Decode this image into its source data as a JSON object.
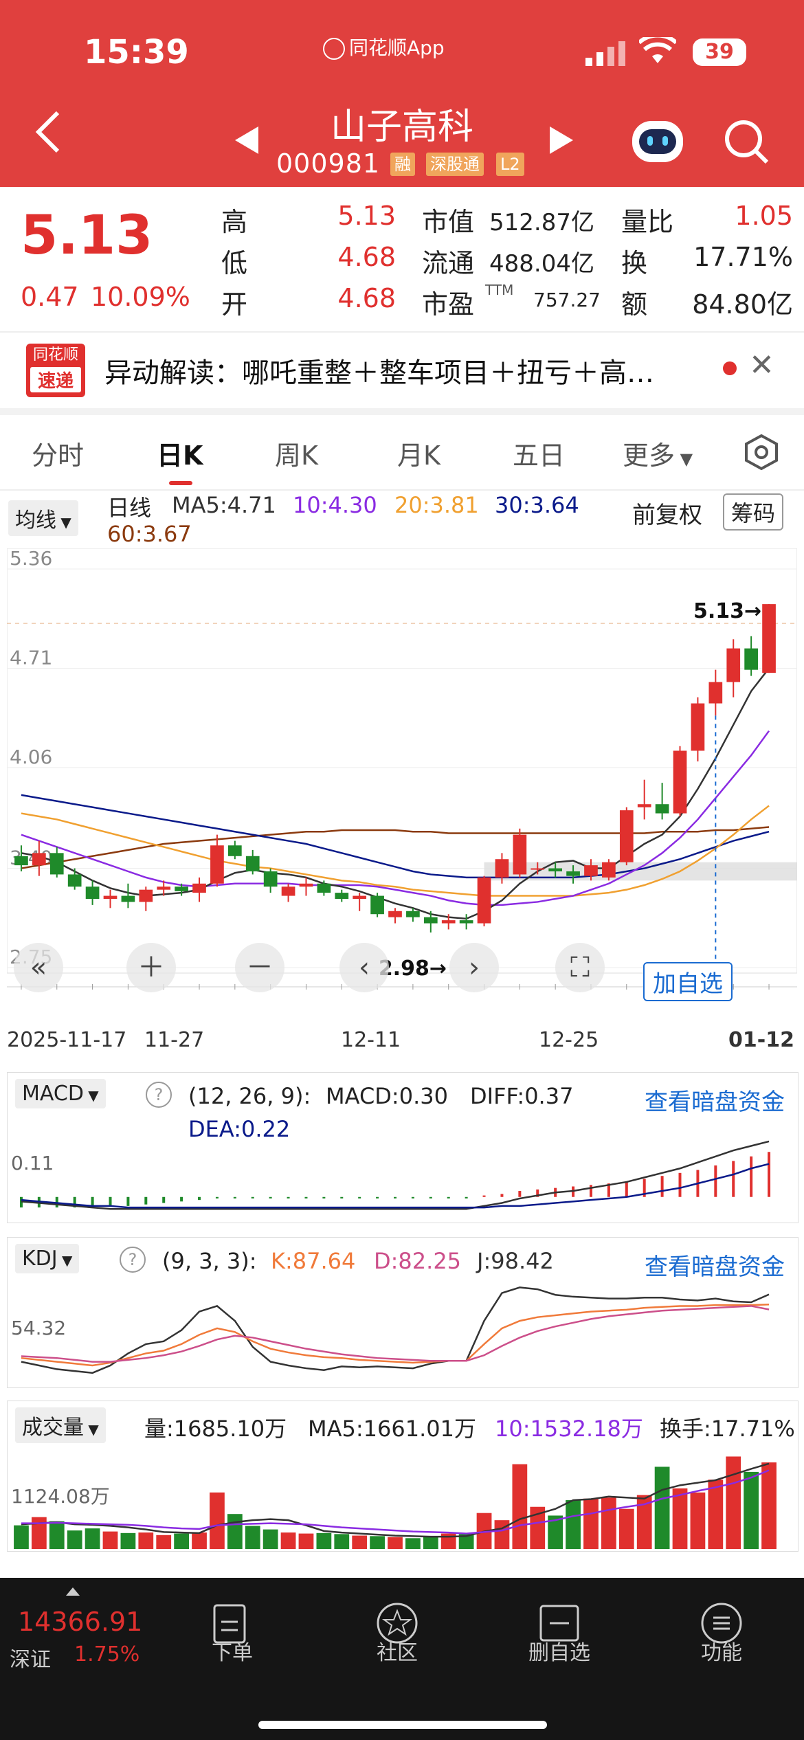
{
  "status": {
    "time": "15:39",
    "app": "同花顺App",
    "battery": "39"
  },
  "header": {
    "title": "山子高科",
    "code": "000981",
    "tags": [
      "融",
      "深股通",
      "L2"
    ]
  },
  "quote": {
    "price": "5.13",
    "change": "0.47",
    "pct": "10.09%",
    "rows": [
      {
        "l1": "高",
        "v1": "5.13",
        "l2": "市值",
        "v2": "512.87亿",
        "l3": "量比",
        "v3": "1.05"
      },
      {
        "l1": "低",
        "v1": "4.68",
        "l2": "流通",
        "v2": "488.04亿",
        "l3": "换",
        "v3": "17.71%"
      },
      {
        "l1": "开",
        "v1": "4.68",
        "l2": "市盈",
        "v2sup": "TTM",
        "v2": "757.27",
        "l3": "额",
        "v3": "84.80亿"
      }
    ]
  },
  "news": {
    "brand1": "同花顺",
    "brand2": "速递",
    "text": "异动解读：哪吒重整＋整车项目＋扭亏＋高…"
  },
  "tabs": [
    "分时",
    "日K",
    "周K",
    "月K",
    "五日",
    "更多"
  ],
  "active_tab": "日K",
  "ma_bar": {
    "indicator": "均线",
    "label": "日线",
    "ma5": "MA5:4.71",
    "ma10": "10:4.30",
    "ma20": "20:3.81",
    "ma30": "30:3.64",
    "ma60": "60:3.67",
    "adjust": "前复权",
    "chips": "筹码"
  },
  "colors": {
    "ma5": "#333333",
    "ma10": "#8a2be2",
    "ma20": "#f0a030",
    "ma30": "#0a1a8a",
    "ma60": "#8b3a0e",
    "up": "#e0302e",
    "down": "#1f8a2a"
  },
  "kline": {
    "y_ticks": [
      "5.36",
      "4.71",
      "4.06",
      "3.40",
      "2.75"
    ],
    "x_labels": [
      "2025-11-17",
      "11-27",
      "12-11",
      "12-25",
      "01-12"
    ],
    "high_label": "5.13→",
    "low_label": "2.98→",
    "add_watch": "加自选"
  },
  "chart_data": [
    {
      "type": "candlestick",
      "title": "日线",
      "ylim": [
        2.75,
        5.36
      ],
      "ohlc": [
        [
          3.48,
          3.55,
          3.38,
          3.42
        ],
        [
          3.42,
          3.58,
          3.35,
          3.5
        ],
        [
          3.5,
          3.54,
          3.34,
          3.36
        ],
        [
          3.36,
          3.4,
          3.26,
          3.28
        ],
        [
          3.28,
          3.32,
          3.16,
          3.2
        ],
        [
          3.2,
          3.26,
          3.14,
          3.22
        ],
        [
          3.22,
          3.3,
          3.14,
          3.18
        ],
        [
          3.18,
          3.28,
          3.12,
          3.26
        ],
        [
          3.26,
          3.32,
          3.22,
          3.28
        ],
        [
          3.28,
          3.3,
          3.22,
          3.25
        ],
        [
          3.24,
          3.34,
          3.18,
          3.3
        ],
        [
          3.3,
          3.62,
          3.28,
          3.55
        ],
        [
          3.55,
          3.58,
          3.46,
          3.48
        ],
        [
          3.48,
          3.52,
          3.36,
          3.38
        ],
        [
          3.38,
          3.4,
          3.24,
          3.28
        ],
        [
          3.22,
          3.3,
          3.18,
          3.28
        ],
        [
          3.28,
          3.34,
          3.22,
          3.3
        ],
        [
          3.3,
          3.32,
          3.22,
          3.24
        ],
        [
          3.24,
          3.26,
          3.18,
          3.2
        ],
        [
          3.2,
          3.24,
          3.12,
          3.22
        ],
        [
          3.22,
          3.24,
          3.08,
          3.1
        ],
        [
          3.08,
          3.14,
          3.04,
          3.12
        ],
        [
          3.12,
          3.14,
          3.05,
          3.08
        ],
        [
          3.08,
          3.12,
          2.98,
          3.04
        ],
        [
          3.04,
          3.1,
          3.0,
          3.06
        ],
        [
          3.06,
          3.1,
          3.0,
          3.04
        ],
        [
          3.04,
          3.35,
          3.02,
          3.34
        ],
        [
          3.34,
          3.5,
          3.3,
          3.46
        ],
        [
          3.36,
          3.66,
          3.34,
          3.62
        ],
        [
          3.4,
          3.44,
          3.36,
          3.4
        ],
        [
          3.4,
          3.44,
          3.34,
          3.38
        ],
        [
          3.38,
          3.42,
          3.3,
          3.35
        ],
        [
          3.35,
          3.46,
          3.32,
          3.42
        ],
        [
          3.34,
          3.46,
          3.32,
          3.44
        ],
        [
          3.44,
          3.8,
          3.42,
          3.78
        ],
        [
          3.8,
          3.98,
          3.72,
          3.82
        ],
        [
          3.82,
          3.96,
          3.72,
          3.76
        ],
        [
          3.76,
          4.2,
          3.74,
          4.17
        ],
        [
          4.17,
          4.52,
          4.1,
          4.48
        ],
        [
          4.48,
          4.7,
          4.4,
          4.62
        ],
        [
          4.62,
          4.9,
          4.52,
          4.84
        ],
        [
          4.84,
          4.92,
          4.66,
          4.7
        ],
        [
          4.68,
          5.13,
          4.68,
          5.13
        ]
      ],
      "ma5": [
        3.5,
        3.48,
        3.44,
        3.38,
        3.32,
        3.27,
        3.24,
        3.22,
        3.23,
        3.24,
        3.26,
        3.32,
        3.37,
        3.39,
        3.37,
        3.36,
        3.34,
        3.3,
        3.28,
        3.25,
        3.21,
        3.17,
        3.14,
        3.1,
        3.08,
        3.07,
        3.12,
        3.19,
        3.3,
        3.38,
        3.44,
        3.45,
        3.4,
        3.4,
        3.48,
        3.56,
        3.62,
        3.74,
        3.92,
        4.12,
        4.34,
        4.56,
        4.71
      ],
      "ma10": [
        3.62,
        3.58,
        3.54,
        3.5,
        3.46,
        3.42,
        3.38,
        3.34,
        3.31,
        3.29,
        3.28,
        3.29,
        3.3,
        3.3,
        3.3,
        3.3,
        3.29,
        3.29,
        3.29,
        3.29,
        3.28,
        3.26,
        3.24,
        3.22,
        3.19,
        3.17,
        3.16,
        3.16,
        3.17,
        3.18,
        3.2,
        3.22,
        3.26,
        3.3,
        3.36,
        3.42,
        3.5,
        3.6,
        3.72,
        3.86,
        4.0,
        4.14,
        4.3
      ],
      "ma20": [
        3.76,
        3.74,
        3.72,
        3.69,
        3.66,
        3.63,
        3.6,
        3.57,
        3.54,
        3.51,
        3.48,
        3.45,
        3.43,
        3.41,
        3.4,
        3.38,
        3.36,
        3.34,
        3.32,
        3.31,
        3.29,
        3.28,
        3.26,
        3.25,
        3.24,
        3.23,
        3.22,
        3.22,
        3.22,
        3.22,
        3.22,
        3.22,
        3.23,
        3.24,
        3.26,
        3.29,
        3.33,
        3.38,
        3.45,
        3.53,
        3.62,
        3.72,
        3.81
      ],
      "ma30": [
        3.88,
        3.86,
        3.84,
        3.82,
        3.8,
        3.78,
        3.76,
        3.74,
        3.72,
        3.7,
        3.68,
        3.66,
        3.64,
        3.62,
        3.6,
        3.58,
        3.56,
        3.53,
        3.5,
        3.47,
        3.44,
        3.41,
        3.38,
        3.36,
        3.35,
        3.34,
        3.34,
        3.34,
        3.34,
        3.34,
        3.34,
        3.34,
        3.35,
        3.36,
        3.38,
        3.4,
        3.43,
        3.46,
        3.5,
        3.54,
        3.58,
        3.61,
        3.64
      ],
      "ma60": [
        3.4,
        3.42,
        3.44,
        3.46,
        3.48,
        3.5,
        3.52,
        3.54,
        3.56,
        3.57,
        3.58,
        3.59,
        3.6,
        3.61,
        3.62,
        3.63,
        3.64,
        3.64,
        3.65,
        3.65,
        3.65,
        3.65,
        3.64,
        3.64,
        3.63,
        3.63,
        3.63,
        3.63,
        3.63,
        3.63,
        3.63,
        3.63,
        3.63,
        3.63,
        3.63,
        3.63,
        3.64,
        3.64,
        3.64,
        3.65,
        3.65,
        3.66,
        3.67
      ]
    },
    {
      "type": "bar",
      "title": "MACD",
      "params": "(12, 26, 9):",
      "macd_label": "MACD:0.30",
      "diff_label": "DIFF:0.37",
      "dea_label": "DEA:0.22",
      "y_tick": "0.11",
      "macd": [
        -0.07,
        -0.07,
        -0.07,
        -0.07,
        -0.07,
        -0.06,
        -0.06,
        -0.05,
        -0.04,
        -0.03,
        -0.02,
        -0.01,
        -0.01,
        -0.01,
        -0.01,
        -0.01,
        -0.01,
        -0.01,
        -0.01,
        -0.01,
        -0.01,
        -0.01,
        -0.01,
        -0.01,
        -0.01,
        -0.01,
        0.01,
        0.02,
        0.04,
        0.05,
        0.06,
        0.07,
        0.08,
        0.09,
        0.1,
        0.12,
        0.14,
        0.16,
        0.18,
        0.21,
        0.24,
        0.27,
        0.3
      ],
      "diff": [
        -0.03,
        -0.04,
        -0.05,
        -0.06,
        -0.07,
        -0.08,
        -0.08,
        -0.08,
        -0.08,
        -0.08,
        -0.08,
        -0.08,
        -0.08,
        -0.08,
        -0.08,
        -0.08,
        -0.08,
        -0.08,
        -0.08,
        -0.08,
        -0.08,
        -0.08,
        -0.08,
        -0.08,
        -0.08,
        -0.08,
        -0.06,
        -0.04,
        -0.01,
        0.01,
        0.03,
        0.04,
        0.06,
        0.08,
        0.1,
        0.13,
        0.16,
        0.19,
        0.23,
        0.27,
        0.31,
        0.34,
        0.37
      ],
      "dea": [
        -0.02,
        -0.03,
        -0.04,
        -0.05,
        -0.06,
        -0.06,
        -0.07,
        -0.07,
        -0.07,
        -0.07,
        -0.07,
        -0.07,
        -0.07,
        -0.07,
        -0.07,
        -0.07,
        -0.07,
        -0.07,
        -0.07,
        -0.07,
        -0.07,
        -0.07,
        -0.07,
        -0.07,
        -0.07,
        -0.07,
        -0.07,
        -0.06,
        -0.06,
        -0.05,
        -0.04,
        -0.03,
        -0.02,
        -0.01,
        0.0,
        0.02,
        0.04,
        0.06,
        0.09,
        0.12,
        0.15,
        0.19,
        0.22
      ]
    },
    {
      "type": "line",
      "title": "KDJ",
      "params": "(9, 3, 3):",
      "k_label": "K:87.64",
      "d_label": "D:82.25",
      "j_label": "J:98.42",
      "y_tick": "54.32",
      "k": [
        30,
        28,
        26,
        24,
        22,
        25,
        30,
        35,
        38,
        45,
        55,
        62,
        58,
        48,
        40,
        36,
        33,
        31,
        30,
        28,
        27,
        26,
        25,
        26,
        27,
        27,
        45,
        62,
        70,
        74,
        76,
        78,
        80,
        81,
        82,
        84,
        85,
        86,
        86,
        87,
        87,
        87,
        87.64
      ],
      "d": [
        32,
        31,
        30,
        28,
        26,
        26,
        28,
        30,
        33,
        37,
        43,
        50,
        54,
        52,
        48,
        44,
        40,
        37,
        34,
        32,
        30,
        29,
        28,
        27,
        27,
        27,
        33,
        43,
        52,
        59,
        64,
        68,
        72,
        75,
        77,
        79,
        81,
        82,
        83,
        84,
        85,
        86,
        82.25
      ],
      "j": [
        26,
        22,
        18,
        16,
        14,
        22,
        35,
        45,
        48,
        60,
        80,
        86,
        70,
        42,
        26,
        22,
        19,
        17,
        21,
        20,
        21,
        20,
        19,
        24,
        27,
        27,
        70,
        100,
        106,
        104,
        98,
        96,
        95,
        94,
        94,
        95,
        95,
        93,
        92,
        94,
        91,
        90,
        98.42
      ]
    },
    {
      "type": "bar",
      "title": "成交量",
      "vol_label": "量:1685.10万",
      "ma5_label": "MA5:1661.01万",
      "ma10_label": "10:1532.18万",
      "turn_label": "换手:17.71%",
      "y_tick": "1124.08万",
      "volume": [
        460,
        620,
        540,
        360,
        400,
        340,
        310,
        320,
        270,
        300,
        320,
        1100,
        680,
        450,
        380,
        320,
        300,
        310,
        290,
        260,
        250,
        230,
        210,
        230,
        300,
        290,
        700,
        560,
        1650,
        820,
        650,
        950,
        980,
        1000,
        780,
        1050,
        1600,
        1180,
        1100,
        1350,
        1800,
        1500,
        1685.1
      ],
      "vol_ma5": [
        480,
        500,
        520,
        480,
        470,
        450,
        420,
        380,
        330,
        320,
        310,
        460,
        520,
        560,
        580,
        560,
        460,
        350,
        320,
        300,
        280,
        260,
        250,
        240,
        240,
        250,
        340,
        400,
        580,
        680,
        780,
        950,
        970,
        1020,
        1000,
        980,
        1150,
        1240,
        1290,
        1340,
        1450,
        1560,
        1661.01
      ],
      "vol_ma10": [
        500,
        500,
        510,
        500,
        490,
        480,
        470,
        450,
        420,
        400,
        390,
        460,
        480,
        490,
        500,
        490,
        480,
        450,
        420,
        400,
        380,
        360,
        340,
        330,
        320,
        300,
        330,
        360,
        460,
        510,
        560,
        640,
        690,
        760,
        820,
        870,
        980,
        1050,
        1130,
        1200,
        1280,
        1390,
        1532.18
      ]
    }
  ],
  "macd_panel": {
    "title": "MACD",
    "params": "(12, 26, 9):",
    "macd": "MACD:0.30",
    "diff": "DIFF:0.37",
    "dea": "DEA:0.22",
    "y_tick": "0.11",
    "link": "查看暗盘资金"
  },
  "kdj_panel": {
    "title": "KDJ",
    "params": "(9, 3, 3):",
    "k": "K:87.64",
    "d": "D:82.25",
    "j": "J:98.42",
    "y_tick": "54.32",
    "link": "查看暗盘资金"
  },
  "vol_panel": {
    "title": "成交量",
    "vol": "量:1685.10万",
    "ma5": "MA5:1661.01万",
    "ma10": "10:1532.18万",
    "turn": "换手:17.71%",
    "y_tick": "1124.08万"
  },
  "bottom": {
    "index": "14366.91",
    "index_name": "深证",
    "index_pct": "1.75%",
    "items": [
      "下单",
      "社区",
      "删自选",
      "功能"
    ]
  }
}
